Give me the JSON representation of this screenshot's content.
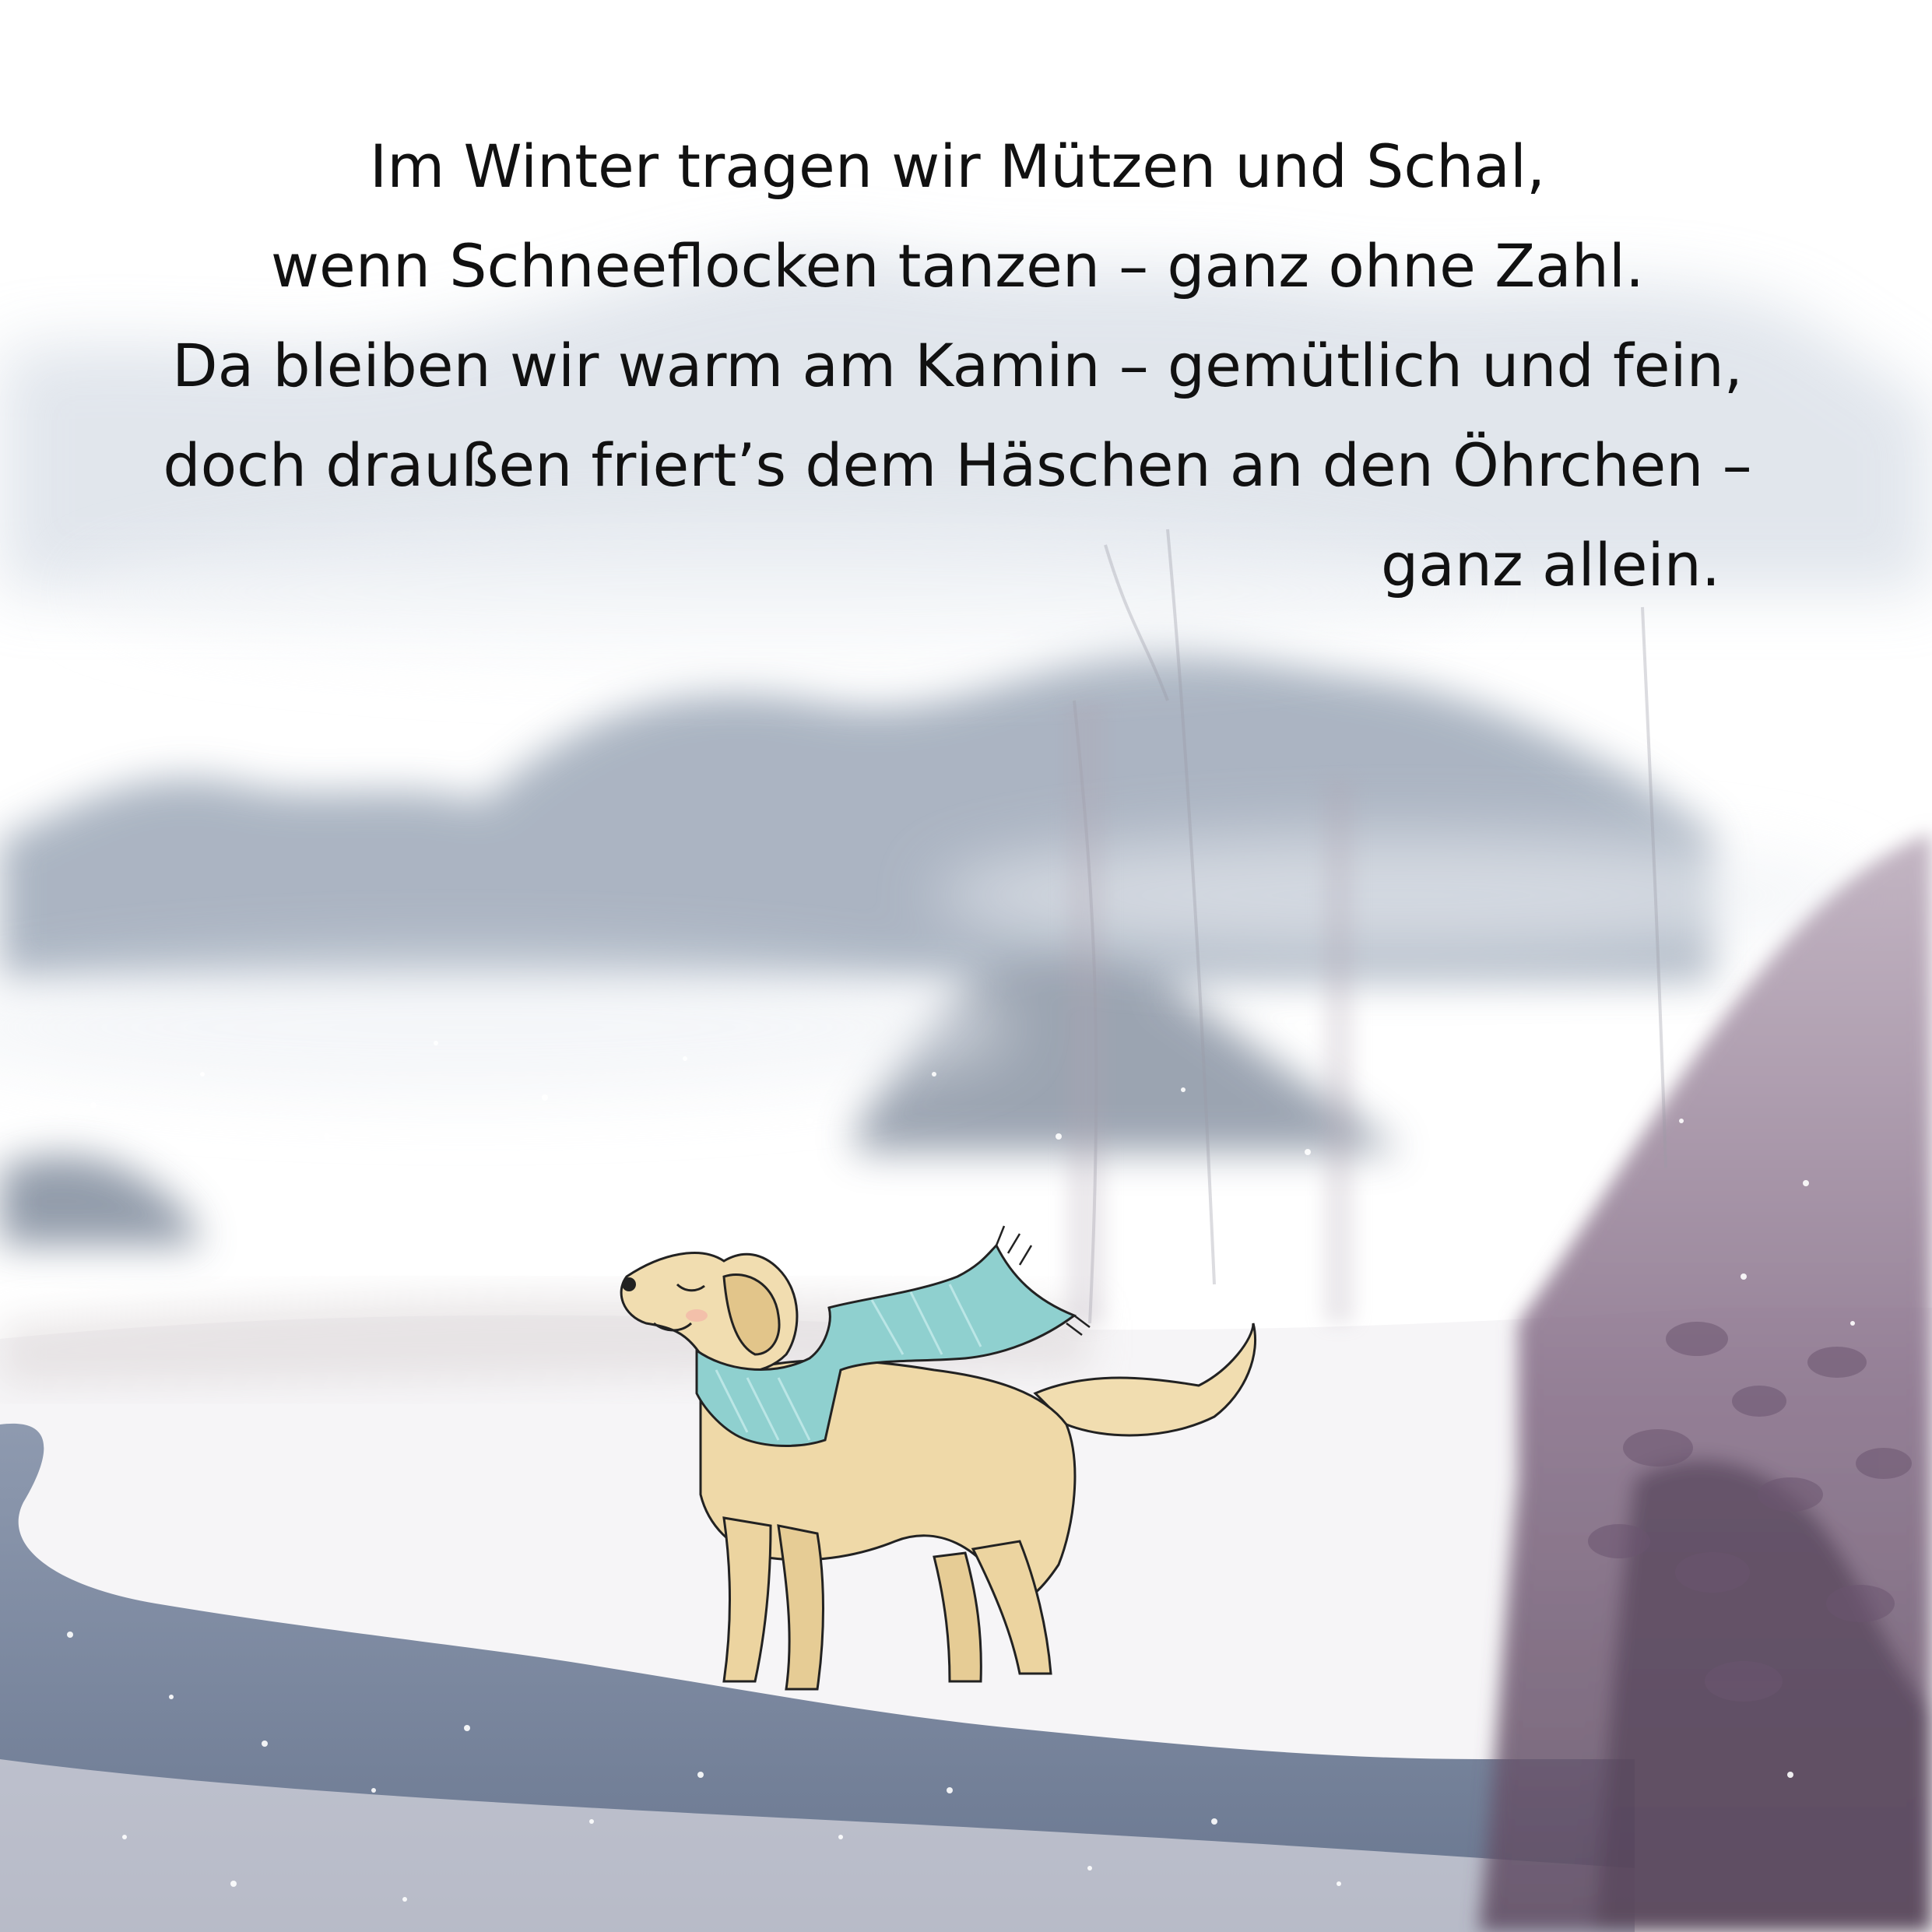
{
  "verse": {
    "lines": [
      "Im Winter tragen wir Mützen und Schal,",
      "wenn Schneeflocken tanzen – ganz ohne Zahl.",
      "Da bleiben wir warm am Kamin – gemütlich und fein,",
      "doch draußen friert’s dem Häschen an den Öhrchen –",
      "ganz allein."
    ]
  },
  "illustration": {
    "subject_icon": "dog-icon",
    "accessory_icon": "scarf-icon",
    "colors": {
      "sky": "#f4f6f9",
      "mountains": "#8e9bab",
      "snow": "#f7f6f8",
      "water": "#5c6f8c",
      "bush": "#6f5670",
      "dog_fur": "#efd9a8",
      "scarf": "#8fd0cf"
    }
  }
}
